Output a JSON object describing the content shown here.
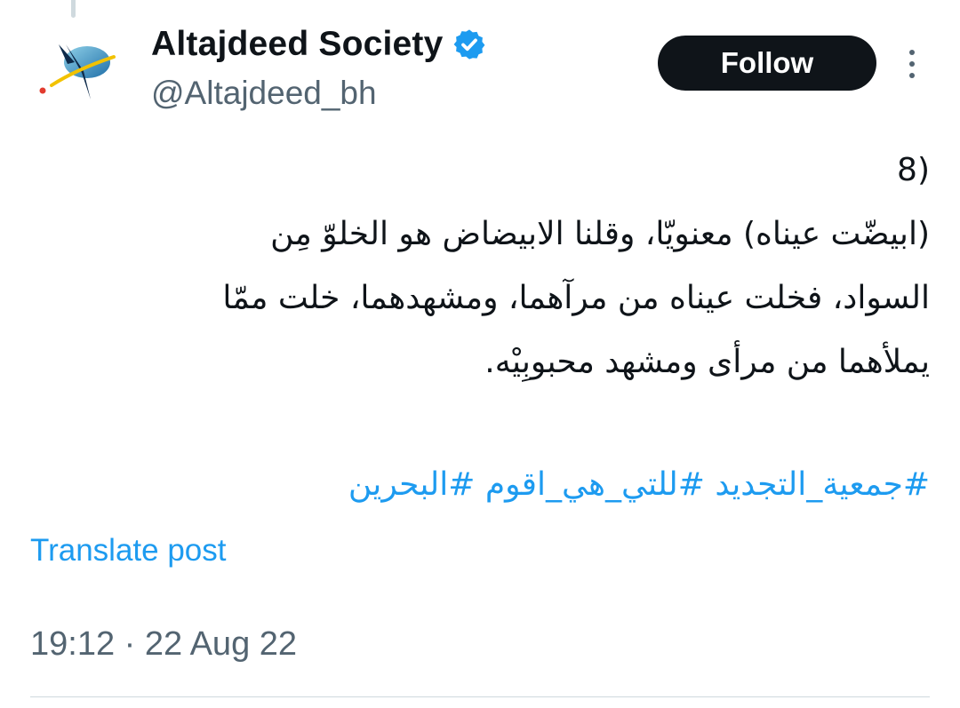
{
  "tweet": {
    "author": {
      "display_name": "Altajdeed Society",
      "handle": "@Altajdeed_bh",
      "verified": true,
      "avatar_icon": "altajdeed-logo"
    },
    "follow_label": "Follow",
    "more_icon": "more-vertical-icon",
    "body_lines": [
      "(8",
      "(ابيضّت عيناه) معنويّا، وقلنا الابيضاض هو الخلوّ مِن",
      "السواد، فخلت عيناه من مرآهما، ومشهدهما، خلت ممّا",
      "يملأهما من مرأى ومشهد محبوبِيْه."
    ],
    "hashtags": [
      "#جمعية_التجديد",
      "#للتي_هي_اقوم",
      "#البحرين"
    ],
    "translate_label": "Translate post",
    "timestamp": "19:12 · 22 Aug 22"
  },
  "colors": {
    "text": "#0f1419",
    "secondary": "#536471",
    "link": "#1d9bf0",
    "button_bg": "#0f1419",
    "divider": "#cfd9de"
  }
}
